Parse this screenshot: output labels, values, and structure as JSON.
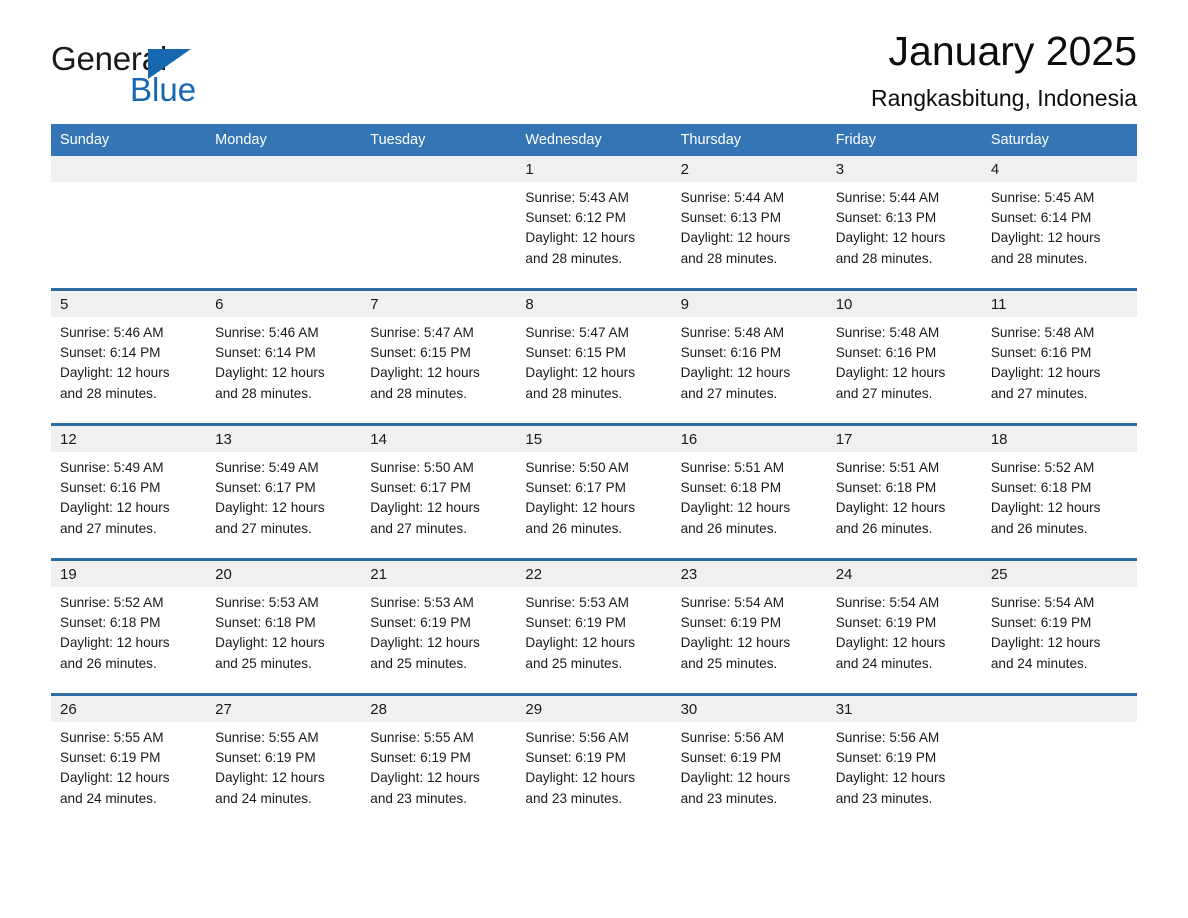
{
  "brand": {
    "word1": "General",
    "word2": "Blue",
    "triangle_color": "#1567b0"
  },
  "header": {
    "title": "January 2025",
    "subtitle": "Rangkasbitung, Indonesia",
    "accent_color": "#3476b5",
    "divider_color": "#2e6da4",
    "daynum_band_color": "#f0f0f0"
  },
  "weekdays": [
    "Sunday",
    "Monday",
    "Tuesday",
    "Wednesday",
    "Thursday",
    "Friday",
    "Saturday"
  ],
  "weeks": [
    [
      {
        "day": "",
        "sunrise": "",
        "sunset": "",
        "daylight": "",
        "daylight2": "",
        "empty": true
      },
      {
        "day": "",
        "sunrise": "",
        "sunset": "",
        "daylight": "",
        "daylight2": "",
        "empty": true
      },
      {
        "day": "",
        "sunrise": "",
        "sunset": "",
        "daylight": "",
        "daylight2": "",
        "empty": true
      },
      {
        "day": "1",
        "sunrise": "Sunrise: 5:43 AM",
        "sunset": "Sunset: 6:12 PM",
        "daylight": "Daylight: 12 hours",
        "daylight2": "and 28 minutes.",
        "empty": false
      },
      {
        "day": "2",
        "sunrise": "Sunrise: 5:44 AM",
        "sunset": "Sunset: 6:13 PM",
        "daylight": "Daylight: 12 hours",
        "daylight2": "and 28 minutes.",
        "empty": false
      },
      {
        "day": "3",
        "sunrise": "Sunrise: 5:44 AM",
        "sunset": "Sunset: 6:13 PM",
        "daylight": "Daylight: 12 hours",
        "daylight2": "and 28 minutes.",
        "empty": false
      },
      {
        "day": "4",
        "sunrise": "Sunrise: 5:45 AM",
        "sunset": "Sunset: 6:14 PM",
        "daylight": "Daylight: 12 hours",
        "daylight2": "and 28 minutes.",
        "empty": false
      }
    ],
    [
      {
        "day": "5",
        "sunrise": "Sunrise: 5:46 AM",
        "sunset": "Sunset: 6:14 PM",
        "daylight": "Daylight: 12 hours",
        "daylight2": "and 28 minutes.",
        "empty": false
      },
      {
        "day": "6",
        "sunrise": "Sunrise: 5:46 AM",
        "sunset": "Sunset: 6:14 PM",
        "daylight": "Daylight: 12 hours",
        "daylight2": "and 28 minutes.",
        "empty": false
      },
      {
        "day": "7",
        "sunrise": "Sunrise: 5:47 AM",
        "sunset": "Sunset: 6:15 PM",
        "daylight": "Daylight: 12 hours",
        "daylight2": "and 28 minutes.",
        "empty": false
      },
      {
        "day": "8",
        "sunrise": "Sunrise: 5:47 AM",
        "sunset": "Sunset: 6:15 PM",
        "daylight": "Daylight: 12 hours",
        "daylight2": "and 28 minutes.",
        "empty": false
      },
      {
        "day": "9",
        "sunrise": "Sunrise: 5:48 AM",
        "sunset": "Sunset: 6:16 PM",
        "daylight": "Daylight: 12 hours",
        "daylight2": "and 27 minutes.",
        "empty": false
      },
      {
        "day": "10",
        "sunrise": "Sunrise: 5:48 AM",
        "sunset": "Sunset: 6:16 PM",
        "daylight": "Daylight: 12 hours",
        "daylight2": "and 27 minutes.",
        "empty": false
      },
      {
        "day": "11",
        "sunrise": "Sunrise: 5:48 AM",
        "sunset": "Sunset: 6:16 PM",
        "daylight": "Daylight: 12 hours",
        "daylight2": "and 27 minutes.",
        "empty": false
      }
    ],
    [
      {
        "day": "12",
        "sunrise": "Sunrise: 5:49 AM",
        "sunset": "Sunset: 6:16 PM",
        "daylight": "Daylight: 12 hours",
        "daylight2": "and 27 minutes.",
        "empty": false
      },
      {
        "day": "13",
        "sunrise": "Sunrise: 5:49 AM",
        "sunset": "Sunset: 6:17 PM",
        "daylight": "Daylight: 12 hours",
        "daylight2": "and 27 minutes.",
        "empty": false
      },
      {
        "day": "14",
        "sunrise": "Sunrise: 5:50 AM",
        "sunset": "Sunset: 6:17 PM",
        "daylight": "Daylight: 12 hours",
        "daylight2": "and 27 minutes.",
        "empty": false
      },
      {
        "day": "15",
        "sunrise": "Sunrise: 5:50 AM",
        "sunset": "Sunset: 6:17 PM",
        "daylight": "Daylight: 12 hours",
        "daylight2": "and 26 minutes.",
        "empty": false
      },
      {
        "day": "16",
        "sunrise": "Sunrise: 5:51 AM",
        "sunset": "Sunset: 6:18 PM",
        "daylight": "Daylight: 12 hours",
        "daylight2": "and 26 minutes.",
        "empty": false
      },
      {
        "day": "17",
        "sunrise": "Sunrise: 5:51 AM",
        "sunset": "Sunset: 6:18 PM",
        "daylight": "Daylight: 12 hours",
        "daylight2": "and 26 minutes.",
        "empty": false
      },
      {
        "day": "18",
        "sunrise": "Sunrise: 5:52 AM",
        "sunset": "Sunset: 6:18 PM",
        "daylight": "Daylight: 12 hours",
        "daylight2": "and 26 minutes.",
        "empty": false
      }
    ],
    [
      {
        "day": "19",
        "sunrise": "Sunrise: 5:52 AM",
        "sunset": "Sunset: 6:18 PM",
        "daylight": "Daylight: 12 hours",
        "daylight2": "and 26 minutes.",
        "empty": false
      },
      {
        "day": "20",
        "sunrise": "Sunrise: 5:53 AM",
        "sunset": "Sunset: 6:18 PM",
        "daylight": "Daylight: 12 hours",
        "daylight2": "and 25 minutes.",
        "empty": false
      },
      {
        "day": "21",
        "sunrise": "Sunrise: 5:53 AM",
        "sunset": "Sunset: 6:19 PM",
        "daylight": "Daylight: 12 hours",
        "daylight2": "and 25 minutes.",
        "empty": false
      },
      {
        "day": "22",
        "sunrise": "Sunrise: 5:53 AM",
        "sunset": "Sunset: 6:19 PM",
        "daylight": "Daylight: 12 hours",
        "daylight2": "and 25 minutes.",
        "empty": false
      },
      {
        "day": "23",
        "sunrise": "Sunrise: 5:54 AM",
        "sunset": "Sunset: 6:19 PM",
        "daylight": "Daylight: 12 hours",
        "daylight2": "and 25 minutes.",
        "empty": false
      },
      {
        "day": "24",
        "sunrise": "Sunrise: 5:54 AM",
        "sunset": "Sunset: 6:19 PM",
        "daylight": "Daylight: 12 hours",
        "daylight2": "and 24 minutes.",
        "empty": false
      },
      {
        "day": "25",
        "sunrise": "Sunrise: 5:54 AM",
        "sunset": "Sunset: 6:19 PM",
        "daylight": "Daylight: 12 hours",
        "daylight2": "and 24 minutes.",
        "empty": false
      }
    ],
    [
      {
        "day": "26",
        "sunrise": "Sunrise: 5:55 AM",
        "sunset": "Sunset: 6:19 PM",
        "daylight": "Daylight: 12 hours",
        "daylight2": "and 24 minutes.",
        "empty": false
      },
      {
        "day": "27",
        "sunrise": "Sunrise: 5:55 AM",
        "sunset": "Sunset: 6:19 PM",
        "daylight": "Daylight: 12 hours",
        "daylight2": "and 24 minutes.",
        "empty": false
      },
      {
        "day": "28",
        "sunrise": "Sunrise: 5:55 AM",
        "sunset": "Sunset: 6:19 PM",
        "daylight": "Daylight: 12 hours",
        "daylight2": "and 23 minutes.",
        "empty": false
      },
      {
        "day": "29",
        "sunrise": "Sunrise: 5:56 AM",
        "sunset": "Sunset: 6:19 PM",
        "daylight": "Daylight: 12 hours",
        "daylight2": "and 23 minutes.",
        "empty": false
      },
      {
        "day": "30",
        "sunrise": "Sunrise: 5:56 AM",
        "sunset": "Sunset: 6:19 PM",
        "daylight": "Daylight: 12 hours",
        "daylight2": "and 23 minutes.",
        "empty": false
      },
      {
        "day": "31",
        "sunrise": "Sunrise: 5:56 AM",
        "sunset": "Sunset: 6:19 PM",
        "daylight": "Daylight: 12 hours",
        "daylight2": "and 23 minutes.",
        "empty": false
      },
      {
        "day": "",
        "sunrise": "",
        "sunset": "",
        "daylight": "",
        "daylight2": "",
        "empty": true
      }
    ]
  ]
}
